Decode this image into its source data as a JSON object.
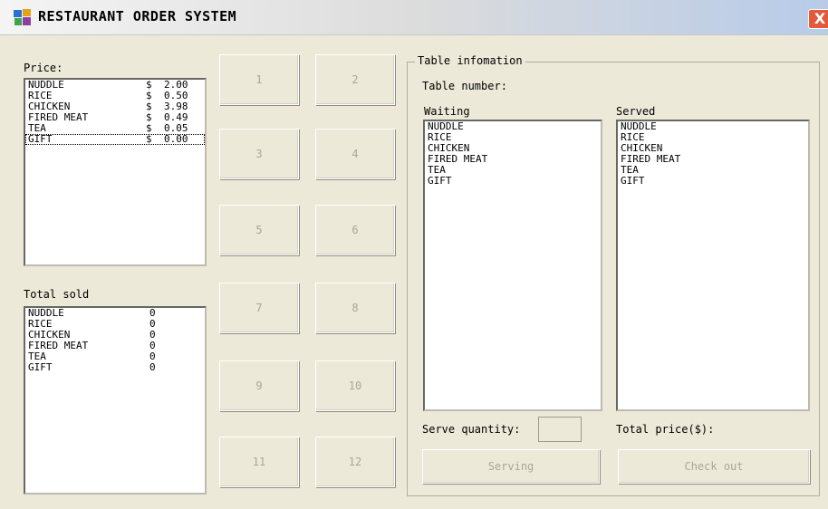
{
  "window": {
    "title": "RESTAURANT ORDER SYSTEM",
    "close_label": "X"
  },
  "price_section": {
    "label": "Price:",
    "items": [
      {
        "name": "NUDDLE",
        "currency": "$",
        "price": "2.00"
      },
      {
        "name": "RICE",
        "currency": "$",
        "price": "0.50"
      },
      {
        "name": "CHICKEN",
        "currency": "$",
        "price": "3.98"
      },
      {
        "name": "FIRED MEAT",
        "currency": "$",
        "price": "0.49"
      },
      {
        "name": "TEA",
        "currency": "$",
        "price": "0.05"
      },
      {
        "name": "GIFT",
        "currency": "$",
        "price": "0.00"
      }
    ],
    "selected_index": 5
  },
  "sold_section": {
    "label": "Total sold",
    "items": [
      {
        "name": "NUDDLE",
        "count": "0"
      },
      {
        "name": "RICE",
        "count": "0"
      },
      {
        "name": "CHICKEN",
        "count": "0"
      },
      {
        "name": "FIRED MEAT",
        "count": "0"
      },
      {
        "name": "TEA",
        "count": "0"
      },
      {
        "name": "GIFT",
        "count": "0"
      }
    ]
  },
  "table_buttons": [
    "1",
    "2",
    "3",
    "4",
    "5",
    "6",
    "7",
    "8",
    "9",
    "10",
    "11",
    "12"
  ],
  "table_info": {
    "group_title": "Table infomation",
    "table_number_label": "Table number:",
    "waiting_label": "Waiting",
    "served_label": "Served",
    "waiting_items": [
      "NUDDLE",
      "RICE",
      "CHICKEN",
      "FIRED MEAT",
      "TEA",
      "GIFT"
    ],
    "served_items": [
      "NUDDLE",
      "RICE",
      "CHICKEN",
      "FIRED MEAT",
      "TEA",
      "GIFT"
    ],
    "serve_quantity_label": "Serve quantity:",
    "serve_quantity_value": "",
    "total_price_label": "Total price($):",
    "serving_button": "Serving",
    "checkout_button": "Check out"
  },
  "colors": {
    "window_bg": "#ece9d8",
    "disabled_text": "#a9a69c",
    "close_button": "#e35a3a"
  }
}
